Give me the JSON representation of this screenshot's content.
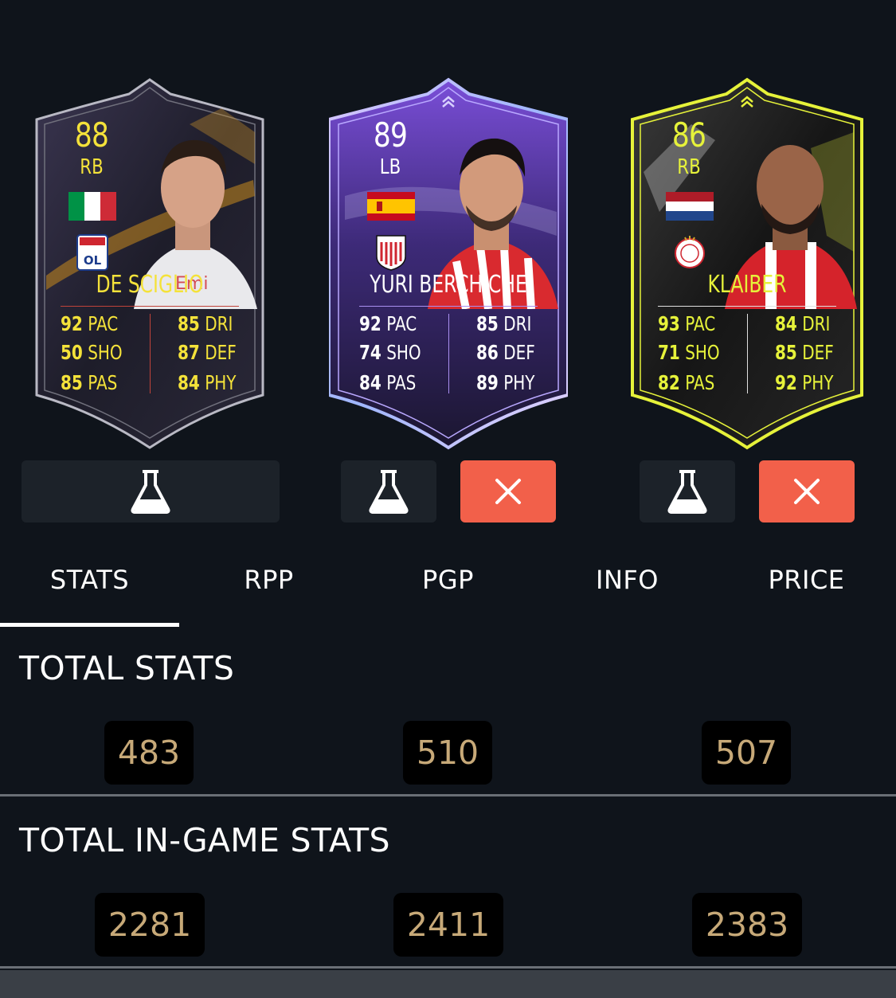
{
  "cards": [
    {
      "rating": "88",
      "position": "RB",
      "name": "DE SCIGLIO",
      "nation": "Italy",
      "club": "Olympique Lyonnais",
      "text_color": "#f4e23a",
      "stats": {
        "pac": {
          "value": "92",
          "label": "PAC"
        },
        "sho": {
          "value": "50",
          "label": "SHO"
        },
        "pas": {
          "value": "85",
          "label": "PAS"
        },
        "dri": {
          "value": "85",
          "label": "DRI"
        },
        "def": {
          "value": "87",
          "label": "DEF"
        },
        "phy": {
          "value": "84",
          "label": "PHY"
        }
      }
    },
    {
      "rating": "89",
      "position": "LB",
      "name": "YURI BERCHICHE",
      "nation": "Spain",
      "club": "Athletic Club",
      "text_color": "#ffffff",
      "stats": {
        "pac": {
          "value": "92",
          "label": "PAC"
        },
        "sho": {
          "value": "74",
          "label": "SHO"
        },
        "pas": {
          "value": "84",
          "label": "PAS"
        },
        "dri": {
          "value": "85",
          "label": "DRI"
        },
        "def": {
          "value": "86",
          "label": "DEF"
        },
        "phy": {
          "value": "89",
          "label": "PHY"
        }
      }
    },
    {
      "rating": "86",
      "position": "RB",
      "name": "KLAIBER",
      "nation": "Netherlands",
      "club": "Ajax",
      "text_color": "#e6f23a",
      "stats": {
        "pac": {
          "value": "93",
          "label": "PAC"
        },
        "sho": {
          "value": "71",
          "label": "SHO"
        },
        "pas": {
          "value": "82",
          "label": "PAS"
        },
        "dri": {
          "value": "84",
          "label": "DRI"
        },
        "def": {
          "value": "85",
          "label": "DEF"
        },
        "phy": {
          "value": "92",
          "label": "PHY"
        }
      }
    }
  ],
  "actions": {
    "lab_icon": "flask-icon",
    "remove_icon": "close-icon",
    "remove_color": "#f2604a"
  },
  "tabs": [
    {
      "label": "STATS",
      "active": true
    },
    {
      "label": "RPP",
      "active": false
    },
    {
      "label": "PGP",
      "active": false
    },
    {
      "label": "INFO",
      "active": false
    },
    {
      "label": "PRICE",
      "active": false
    }
  ],
  "total_stats": {
    "title": "TOTAL STATS",
    "values": [
      "483",
      "510",
      "507"
    ]
  },
  "total_ingame_stats": {
    "title": "TOTAL IN-GAME STATS",
    "values": [
      "2281",
      "2411",
      "2383"
    ]
  },
  "value_color": "#c7a978"
}
